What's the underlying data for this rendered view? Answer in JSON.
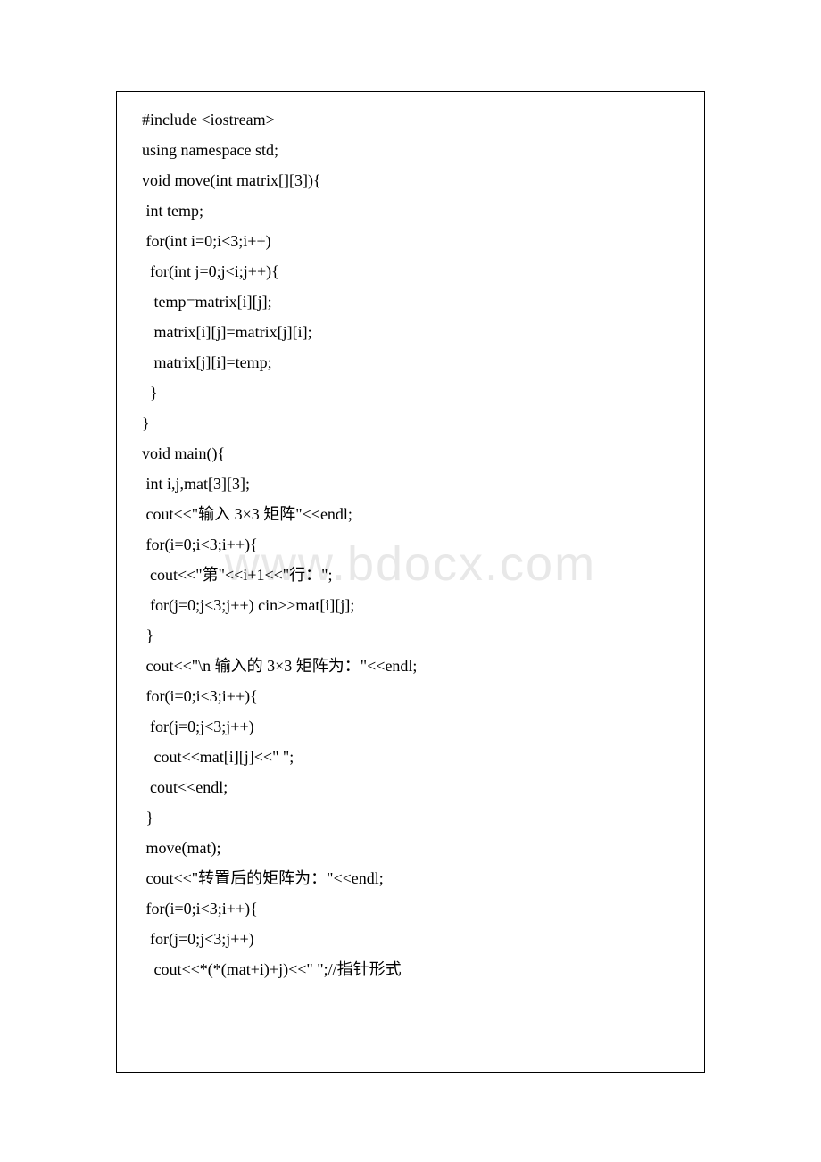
{
  "watermark": "www.bdocx.com",
  "code": {
    "lines": [
      "#include <iostream>",
      "using namespace std;",
      "void move(int matrix[][3]){",
      " int temp;",
      " for(int i=0;i<3;i++)",
      "  for(int j=0;j<i;j++){",
      "   temp=matrix[i][j];",
      "   matrix[i][j]=matrix[j][i];",
      "   matrix[j][i]=temp;",
      "  }",
      "}",
      "void main(){",
      " int i,j,mat[3][3];",
      " cout<<\"输入 3×3 矩阵\"<<endl;",
      " for(i=0;i<3;i++){",
      "  cout<<\"第\"<<i+1<<\"行：\";",
      "  for(j=0;j<3;j++) cin>>mat[i][j];",
      " }",
      " cout<<\"\\n 输入的 3×3 矩阵为：\"<<endl;",
      " for(i=0;i<3;i++){",
      "  for(j=0;j<3;j++)",
      "   cout<<mat[i][j]<<\" \";",
      "  cout<<endl;",
      " }",
      " move(mat);",
      " cout<<\"转置后的矩阵为：\"<<endl;",
      " for(i=0;i<3;i++){",
      "  for(j=0;j<3;j++)",
      "   cout<<*(*(mat+i)+j)<<\" \";//指针形式"
    ]
  }
}
